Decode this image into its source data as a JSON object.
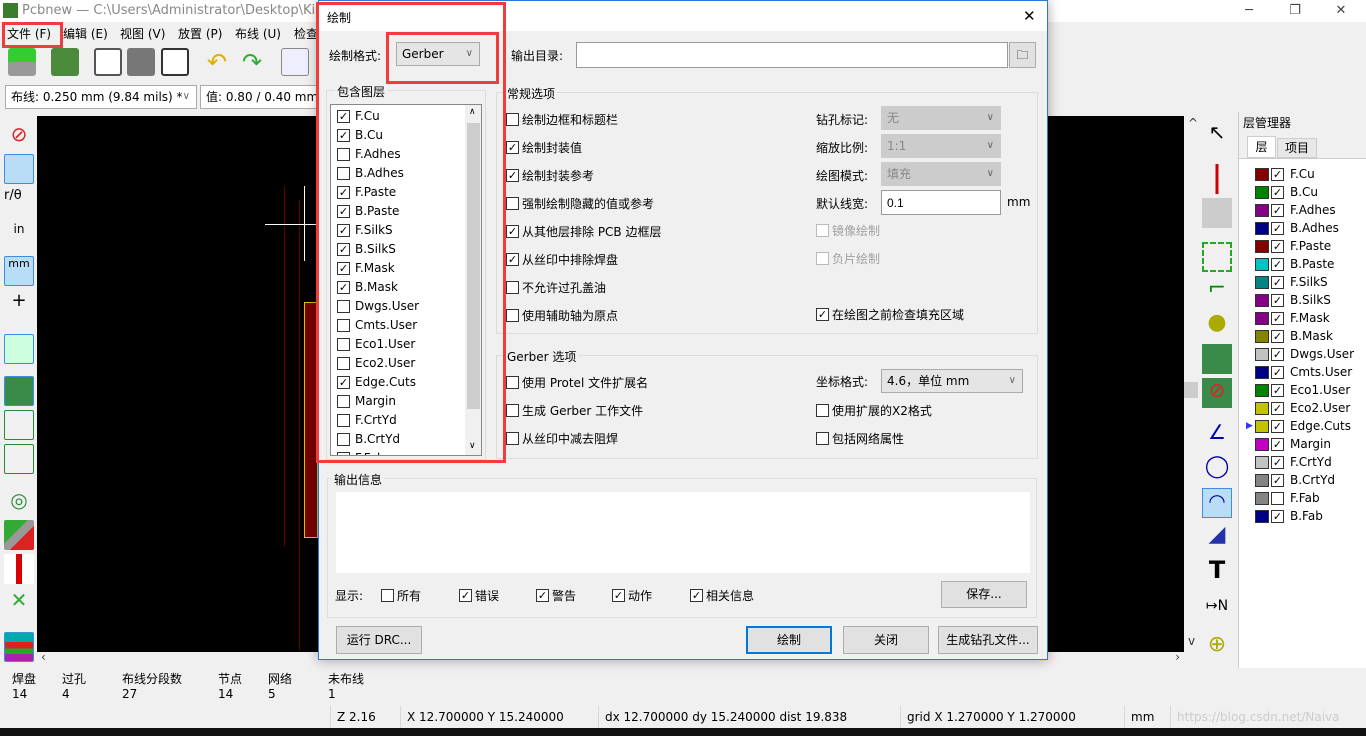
{
  "app": {
    "title": "Pcbnew — C:\\Users\\Administrator\\Desktop\\KiCad",
    "minimize": "─",
    "maximize": "❐",
    "close": "✕"
  },
  "menu": [
    "文件 (F)",
    "编辑 (E)",
    "视图 (V)",
    "放置 (P)",
    "布线 (U)",
    "检查"
  ],
  "toolbar": {
    "track_width": "布线: 0.250 mm (9.84 mils) *",
    "via_size": "值: 0.80 / 0.40 mm"
  },
  "layer_manager": {
    "title": "层管理器",
    "tabs": [
      "层",
      "项目"
    ],
    "active_layer": "Edge.Cuts",
    "layers": [
      {
        "name": "F.Cu",
        "color": "#840000",
        "visible": true
      },
      {
        "name": "B.Cu",
        "color": "#008400",
        "visible": true
      },
      {
        "name": "F.Adhes",
        "color": "#840084",
        "visible": true
      },
      {
        "name": "B.Adhes",
        "color": "#000084",
        "visible": true
      },
      {
        "name": "F.Paste",
        "color": "#840000",
        "visible": true
      },
      {
        "name": "B.Paste",
        "color": "#00c2c2",
        "visible": true
      },
      {
        "name": "F.SilkS",
        "color": "#008484",
        "visible": true
      },
      {
        "name": "B.SilkS",
        "color": "#840084",
        "visible": true
      },
      {
        "name": "F.Mask",
        "color": "#840084",
        "visible": true
      },
      {
        "name": "B.Mask",
        "color": "#848400",
        "visible": true
      },
      {
        "name": "Dwgs.User",
        "color": "#c2c2c2",
        "visible": true
      },
      {
        "name": "Cmts.User",
        "color": "#000084",
        "visible": true
      },
      {
        "name": "Eco1.User",
        "color": "#008400",
        "visible": true
      },
      {
        "name": "Eco2.User",
        "color": "#c2c200",
        "visible": true
      },
      {
        "name": "Edge.Cuts",
        "color": "#c2c200",
        "visible": true
      },
      {
        "name": "Margin",
        "color": "#c200c2",
        "visible": true
      },
      {
        "name": "F.CrtYd",
        "color": "#c2c2c2",
        "visible": true
      },
      {
        "name": "B.CrtYd",
        "color": "#848484",
        "visible": true
      },
      {
        "name": "F.Fab",
        "color": "#848484",
        "visible": false
      },
      {
        "name": "B.Fab",
        "color": "#000084",
        "visible": true
      }
    ]
  },
  "status": {
    "headers": [
      "焊盘",
      "过孔",
      "布线分段数",
      "节点",
      "网络",
      "未布线"
    ],
    "values": [
      "14",
      "4",
      "27",
      "14",
      "5",
      "1"
    ],
    "zoom": "Z 2.16",
    "xy": "X 12.700000  Y 15.240000",
    "dxy": "dx 12.700000  dy 15.240000  dist 19.838",
    "grid": "grid X 1.270000  Y 1.270000",
    "units": "mm",
    "watermark": "https://blog.csdn.net/Naiva"
  },
  "dialog": {
    "title": "绘制",
    "close": "✕",
    "format_label": "绘制格式:",
    "format_value": "Gerber",
    "outdir_label": "输出目录:",
    "outdir_value": "",
    "layers_group": "包含图层",
    "layers": [
      {
        "name": "F.Cu",
        "checked": true
      },
      {
        "name": "B.Cu",
        "checked": true
      },
      {
        "name": "F.Adhes",
        "checked": false
      },
      {
        "name": "B.Adhes",
        "checked": false
      },
      {
        "name": "F.Paste",
        "checked": true
      },
      {
        "name": "B.Paste",
        "checked": true
      },
      {
        "name": "F.SilkS",
        "checked": true
      },
      {
        "name": "B.SilkS",
        "checked": true
      },
      {
        "name": "F.Mask",
        "checked": true
      },
      {
        "name": "B.Mask",
        "checked": true
      },
      {
        "name": "Dwgs.User",
        "checked": false
      },
      {
        "name": "Cmts.User",
        "checked": false
      },
      {
        "name": "Eco1.User",
        "checked": false
      },
      {
        "name": "Eco2.User",
        "checked": false
      },
      {
        "name": "Edge.Cuts",
        "checked": true
      },
      {
        "name": "Margin",
        "checked": false
      },
      {
        "name": "F.CrtYd",
        "checked": false
      },
      {
        "name": "B.CrtYd",
        "checked": false
      },
      {
        "name": "F.Fab",
        "checked": false
      }
    ],
    "general_group": "常规选项",
    "general": [
      {
        "label": "绘制边框和标题栏",
        "checked": false
      },
      {
        "label": "绘制封装值",
        "checked": true
      },
      {
        "label": "绘制封装参考",
        "checked": true
      },
      {
        "label": "强制绘制隐藏的值或参考",
        "checked": false
      },
      {
        "label": "从其他层排除 PCB 边框层",
        "checked": true
      },
      {
        "label": "从丝印中排除焊盘",
        "checked": true
      },
      {
        "label": "不允许过孔盖油",
        "checked": false
      },
      {
        "label": "使用辅助轴为原点",
        "checked": false
      }
    ],
    "drill_label": "钻孔标记:",
    "drill_value": "无",
    "scale_label": "缩放比例:",
    "scale_value": "1:1",
    "mode_label": "绘图模式:",
    "mode_value": "填充",
    "linewidth_label": "默认线宽:",
    "linewidth_value": "0.1",
    "linewidth_unit": "mm",
    "mirror_label": "镜像绘制",
    "mirror_checked": false,
    "negative_label": "负片绘制",
    "negative_checked": false,
    "check_zones_label": "在绘图之前检查填充区域",
    "check_zones_checked": true,
    "gerber_group": "Gerber 选项",
    "gerber": [
      {
        "label": "使用 Protel 文件扩展名",
        "checked": false
      },
      {
        "label": "生成 Gerber 工作文件",
        "checked": false
      },
      {
        "label": "从丝印中减去阻焊",
        "checked": false
      }
    ],
    "coord_label": "坐标格式:",
    "coord_value": "4.6，单位 mm",
    "x2_label": "使用扩展的X2格式",
    "x2_checked": false,
    "netattr_label": "包括网络属性",
    "netattr_checked": false,
    "output_group": "输出信息",
    "output_text": "",
    "show_label": "显示:",
    "filters": [
      {
        "label": "所有",
        "checked": false
      },
      {
        "label": "错误",
        "checked": true
      },
      {
        "label": "警告",
        "checked": true
      },
      {
        "label": "动作",
        "checked": true
      },
      {
        "label": "相关信息",
        "checked": true
      }
    ],
    "save_btn": "保存...",
    "drc_btn": "运行 DRC...",
    "plot_btn": "绘制",
    "close_btn": "关闭",
    "drill_btn": "生成钻孔文件..."
  }
}
